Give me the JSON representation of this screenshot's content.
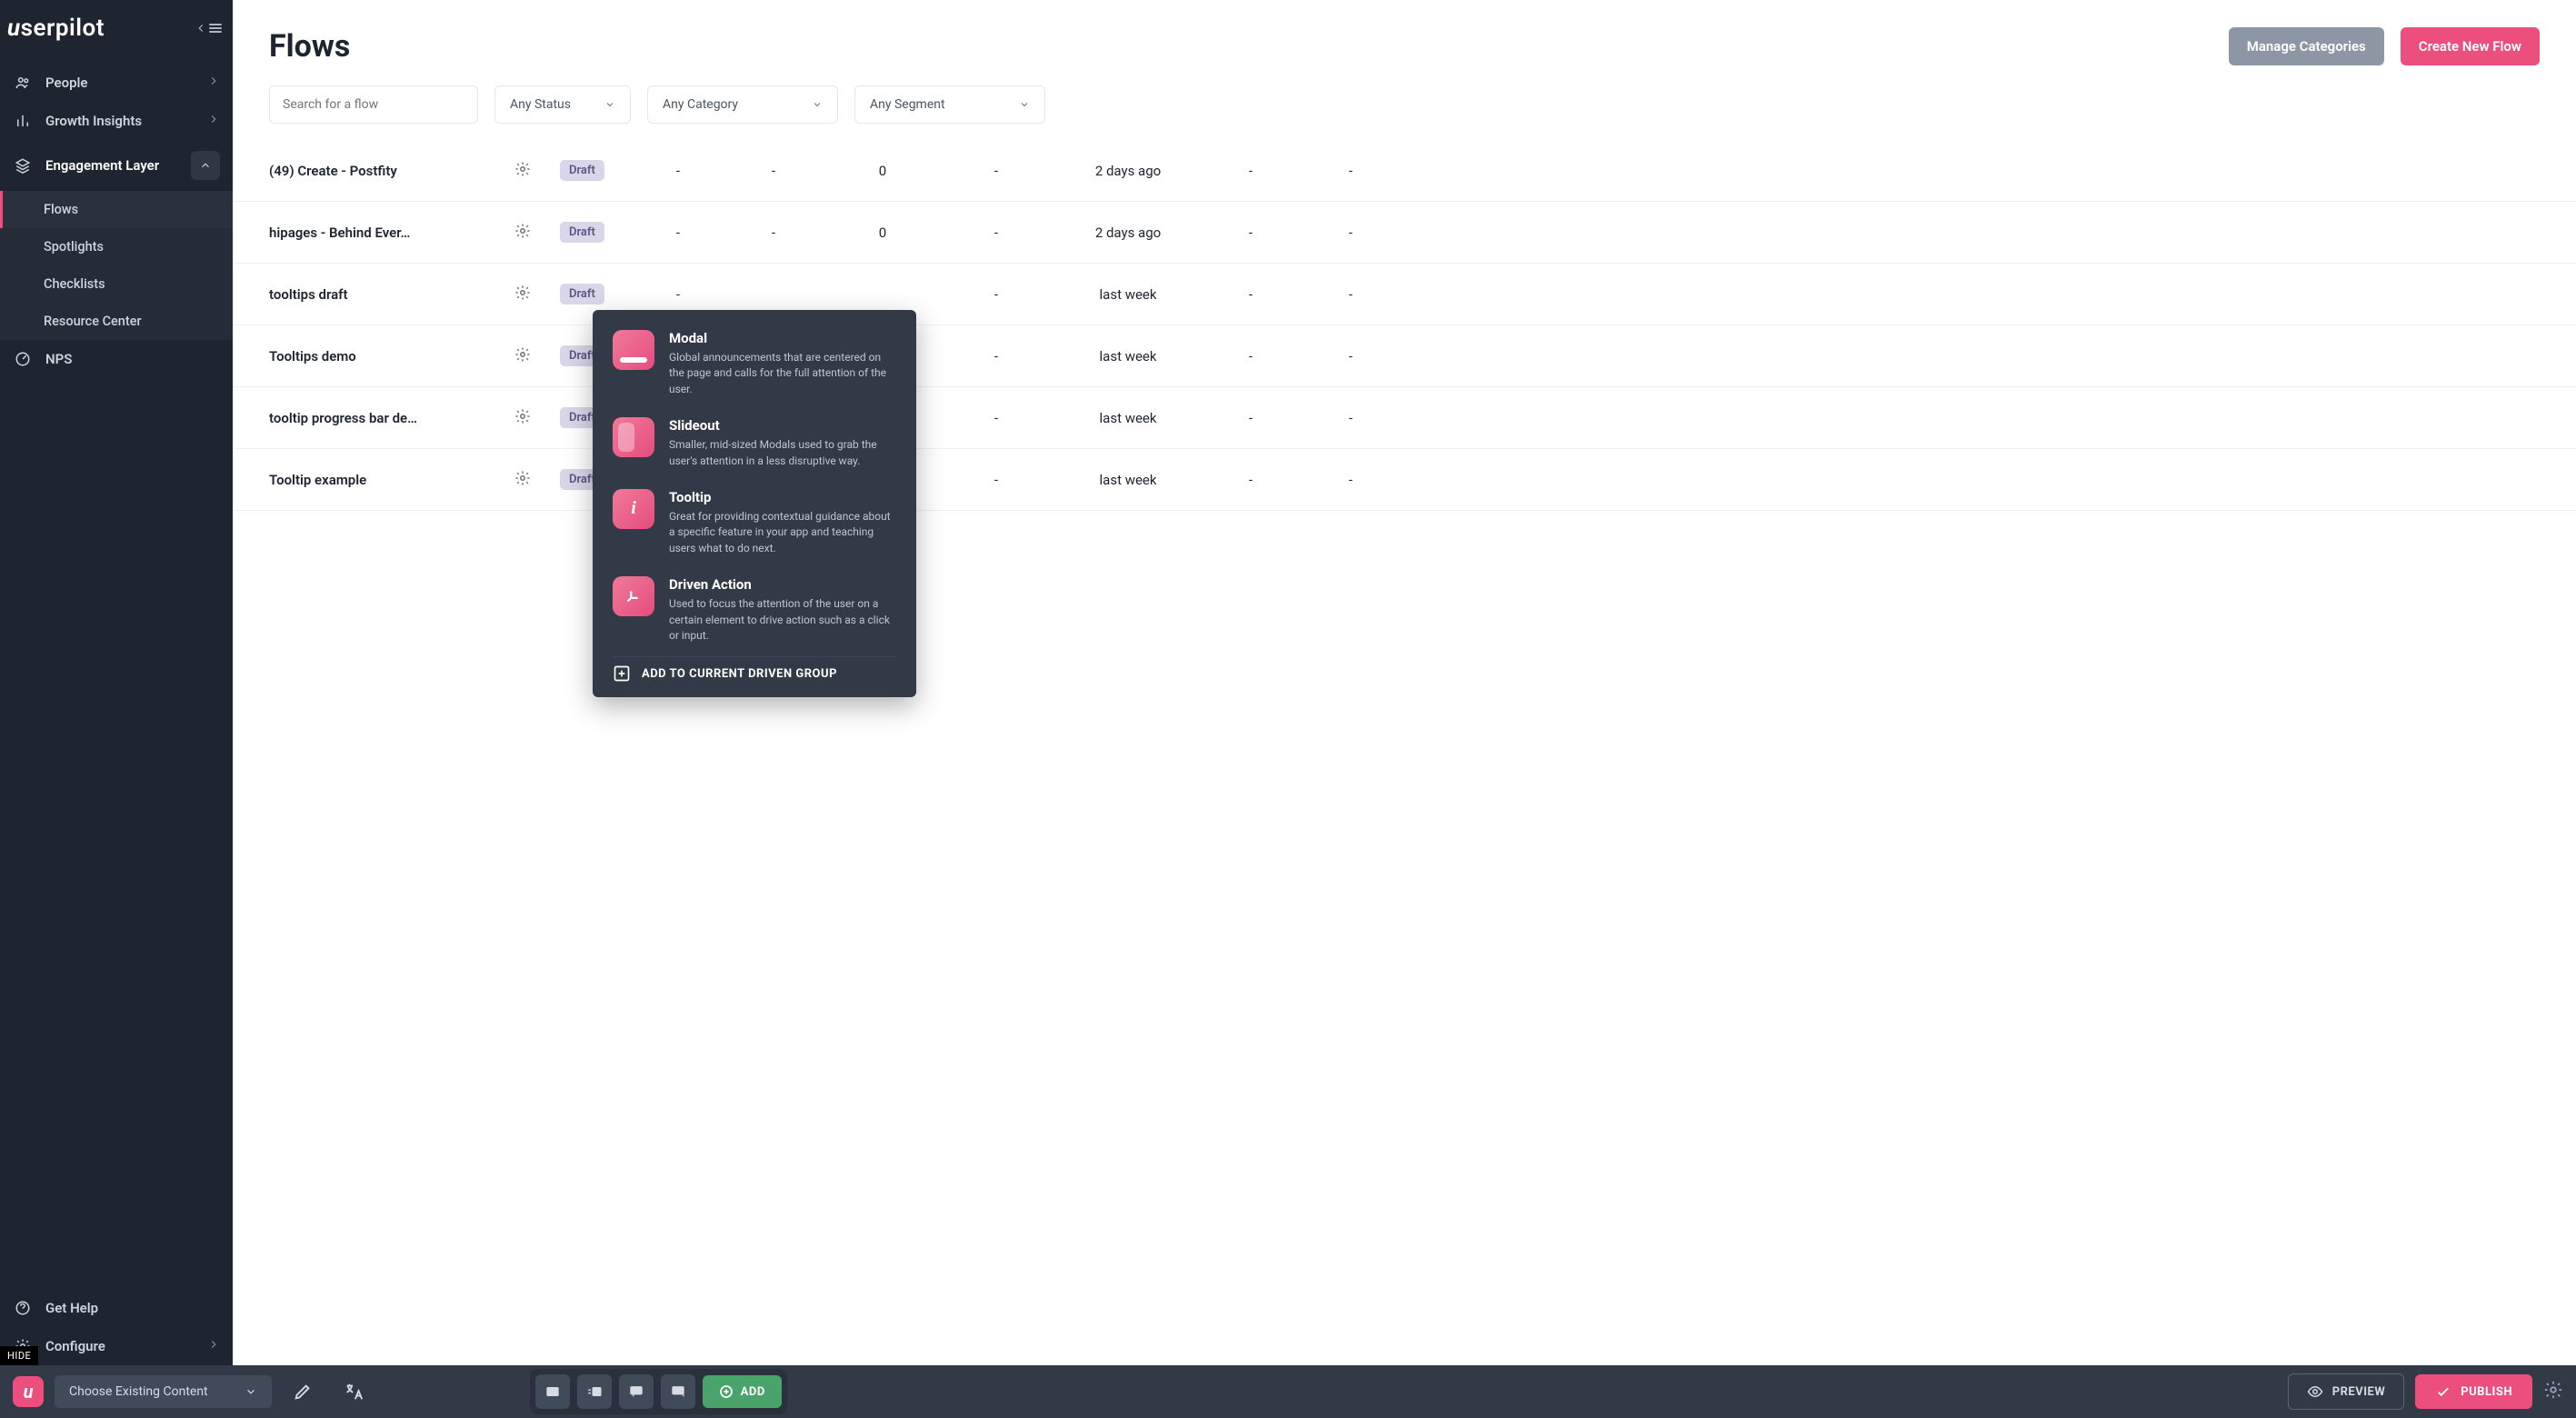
{
  "brand": "userpilot",
  "sidebar": {
    "items": [
      {
        "label": "People"
      },
      {
        "label": "Growth Insights"
      },
      {
        "label": "Engagement Layer"
      },
      {
        "label": "NPS"
      }
    ],
    "sub_engagement": [
      {
        "label": "Flows"
      },
      {
        "label": "Spotlights"
      },
      {
        "label": "Checklists"
      },
      {
        "label": "Resource Center"
      }
    ],
    "footer": [
      {
        "label": "Get Help"
      },
      {
        "label": "Configure"
      }
    ],
    "hide": "HIDE"
  },
  "page": {
    "title": "Flows",
    "manage_categories": "Manage Categories",
    "create_flow": "Create New Flow"
  },
  "filters": {
    "search_placeholder": "Search for a flow",
    "status": "Any Status",
    "category": "Any Category",
    "segment": "Any Segment"
  },
  "badge_label": "Draft",
  "rows": [
    {
      "name": "(49) Create - Postfity",
      "c1": "-",
      "c2": "-",
      "c3": "0",
      "c4": "-",
      "date": "2 days ago",
      "c5": "-",
      "c6": "-"
    },
    {
      "name": "hipages - Behind Ever…",
      "c1": "-",
      "c2": "-",
      "c3": "0",
      "c4": "-",
      "date": "2 days ago",
      "c5": "-",
      "c6": "-"
    },
    {
      "name": "tooltips draft",
      "c1": "-",
      "c2": "",
      "c3": "",
      "c4": "-",
      "date": "last week",
      "c5": "-",
      "c6": "-"
    },
    {
      "name": "Tooltips demo",
      "c1": "-",
      "c2": "",
      "c3": "",
      "c4": "-",
      "date": "last week",
      "c5": "-",
      "c6": "-"
    },
    {
      "name": "tooltip progress bar de…",
      "c1": "-",
      "c2": "",
      "c3": "",
      "c4": "-",
      "date": "last week",
      "c5": "-",
      "c6": "-"
    },
    {
      "name": "Tooltip example",
      "c1": "-",
      "c2": "",
      "c3": "",
      "c4": "-",
      "date": "last week",
      "c5": "-",
      "c6": "-"
    }
  ],
  "popover": {
    "items": [
      {
        "title": "Modal",
        "desc": "Global announcements that are centered on the page and calls for the full attention of the user."
      },
      {
        "title": "Slideout",
        "desc": "Smaller, mid-sized Modals used to grab the user's attention in a less disruptive way."
      },
      {
        "title": "Tooltip",
        "desc": "Great for providing contextual guidance about a specific feature in your app and teaching users what to do next."
      },
      {
        "title": "Driven Action",
        "desc": "Used to focus the attention of the user on a certain element to drive action such as a click or input."
      }
    ],
    "footer": "ADD TO CURRENT DRIVEN GROUP"
  },
  "bottombar": {
    "choose": "Choose Existing Content",
    "add": "ADD",
    "preview": "PREVIEW",
    "publish": "PUBLISH"
  }
}
